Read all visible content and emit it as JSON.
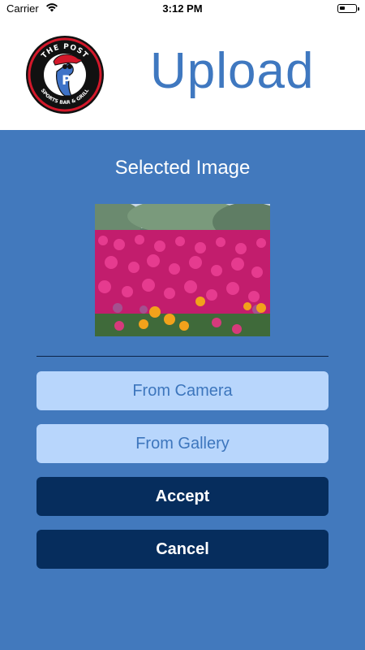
{
  "status_bar": {
    "carrier": "Carrier",
    "time": "3:12 PM"
  },
  "header": {
    "logo": {
      "top_text": "THE POST",
      "bottom_text": "SPORTS BAR & GRILL",
      "letter": "P"
    },
    "title": "Upload"
  },
  "main": {
    "section_title": "Selected Image",
    "selected_image": "flowers-photo",
    "buttons": {
      "camera_label": "From Camera",
      "gallery_label": "From Gallery",
      "accept_label": "Accept",
      "cancel_label": "Cancel"
    }
  },
  "colors": {
    "background": "#4279bd",
    "title": "#3f78c0",
    "light_button": "#b8d6fc",
    "dark_button": "#062d5d"
  }
}
